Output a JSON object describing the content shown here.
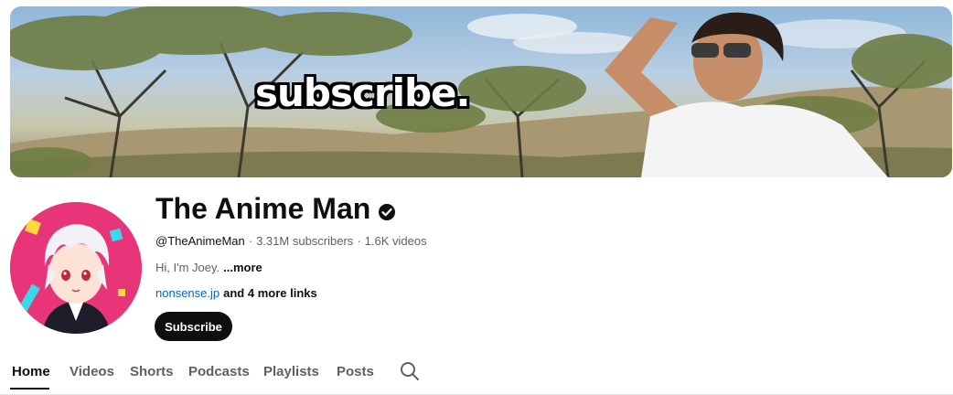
{
  "banner": {
    "overlay_text": "subscribe."
  },
  "channel": {
    "name": "The Anime Man",
    "verified": true,
    "handle": "@TheAnimeMan",
    "subscribers": "3.31M subscribers",
    "videos": "1.6K videos",
    "separator": "·",
    "description": "Hi, I'm Joey.",
    "more_label": "...more",
    "link_text": "nonsense.jp",
    "more_links_label": "and 4 more links"
  },
  "subscribe_label": "Subscribe",
  "tabs": [
    {
      "label": "Home",
      "active": true
    },
    {
      "label": "Videos",
      "active": false
    },
    {
      "label": "Shorts",
      "active": false
    },
    {
      "label": "Podcasts",
      "active": false
    },
    {
      "label": "Playlists",
      "active": false
    },
    {
      "label": "Posts",
      "active": false
    }
  ],
  "icons": {
    "verified": "verified-check-icon",
    "search": "search-icon"
  },
  "colors": {
    "accent_link": "#065fd4",
    "subscribe_bg": "#0f0f0f",
    "text_primary": "#0f0f0f",
    "text_secondary": "#606060",
    "avatar_bg": "#e8357a"
  }
}
